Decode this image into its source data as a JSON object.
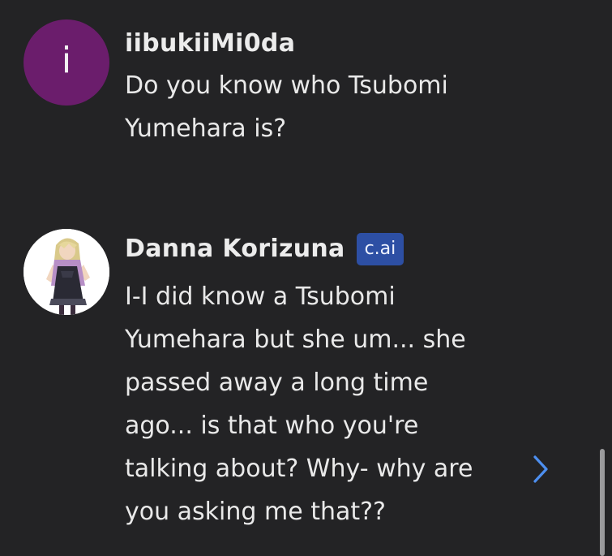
{
  "messages": [
    {
      "author": "iibukiiMi0da",
      "avatar_letter": "i",
      "avatar_color": "#6b1d6c",
      "lines": [
        "Do you know who Tsubomi",
        "Yumehara is?"
      ]
    },
    {
      "author": "Danna Korizuna",
      "badge": "c.ai",
      "badge_color": "#2d4fa4",
      "avatar_icon": "character-portrait",
      "lines": [
        "I-I did know a Tsubomi",
        "Yumehara but she um... she",
        "passed away a long time",
        "ago... is that who you're",
        "talking about? Why- why are",
        "you asking me that??"
      ]
    }
  ],
  "controls": {
    "next_icon": "chevron-right-icon",
    "accent_color": "#4d8ff0"
  },
  "colors": {
    "background": "#232325",
    "text": "#e9e9e9"
  }
}
